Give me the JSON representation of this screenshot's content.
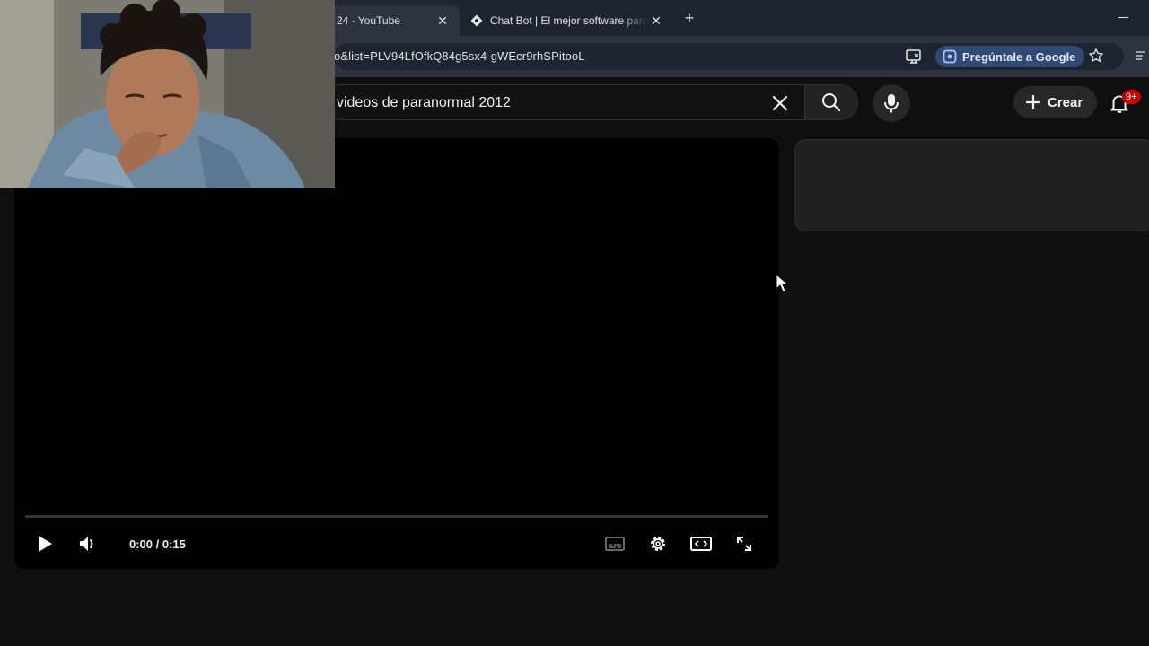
{
  "browser": {
    "active_tab": {
      "title": "24 - YouTube",
      "close": "✕"
    },
    "inactive_tab": {
      "title": "Chat Bot | El mejor software para",
      "close": "✕"
    },
    "new_tab": "+",
    "address_bar": {
      "url_text": "o&list=PLV94LfOfkQ84g5sx4-gWEcr9rhSPitooL",
      "ask_google_label": "Pregúntale a Google"
    }
  },
  "youtube": {
    "search": {
      "query": "videos de paranormal 2012"
    },
    "create_label": "Crear",
    "notifications_badge": "9+"
  },
  "player": {
    "time_display": "0:00 / 0:15",
    "progress": 0
  },
  "colors": {
    "background": "#0f0f0f",
    "progress_red": "#ff0000",
    "badge_red": "#cc0000",
    "ask_google_bg": "#2f4a73"
  },
  "icons": [
    "chatbot-favicon",
    "cast-icon",
    "lens-icon",
    "star-icon",
    "clear-icon",
    "search-icon",
    "mic-icon",
    "plus-icon",
    "bell-icon",
    "play-icon",
    "volume-icon",
    "subtitles-icon",
    "settings-icon",
    "theater-icon",
    "fullscreen-icon",
    "mouse-cursor"
  ]
}
